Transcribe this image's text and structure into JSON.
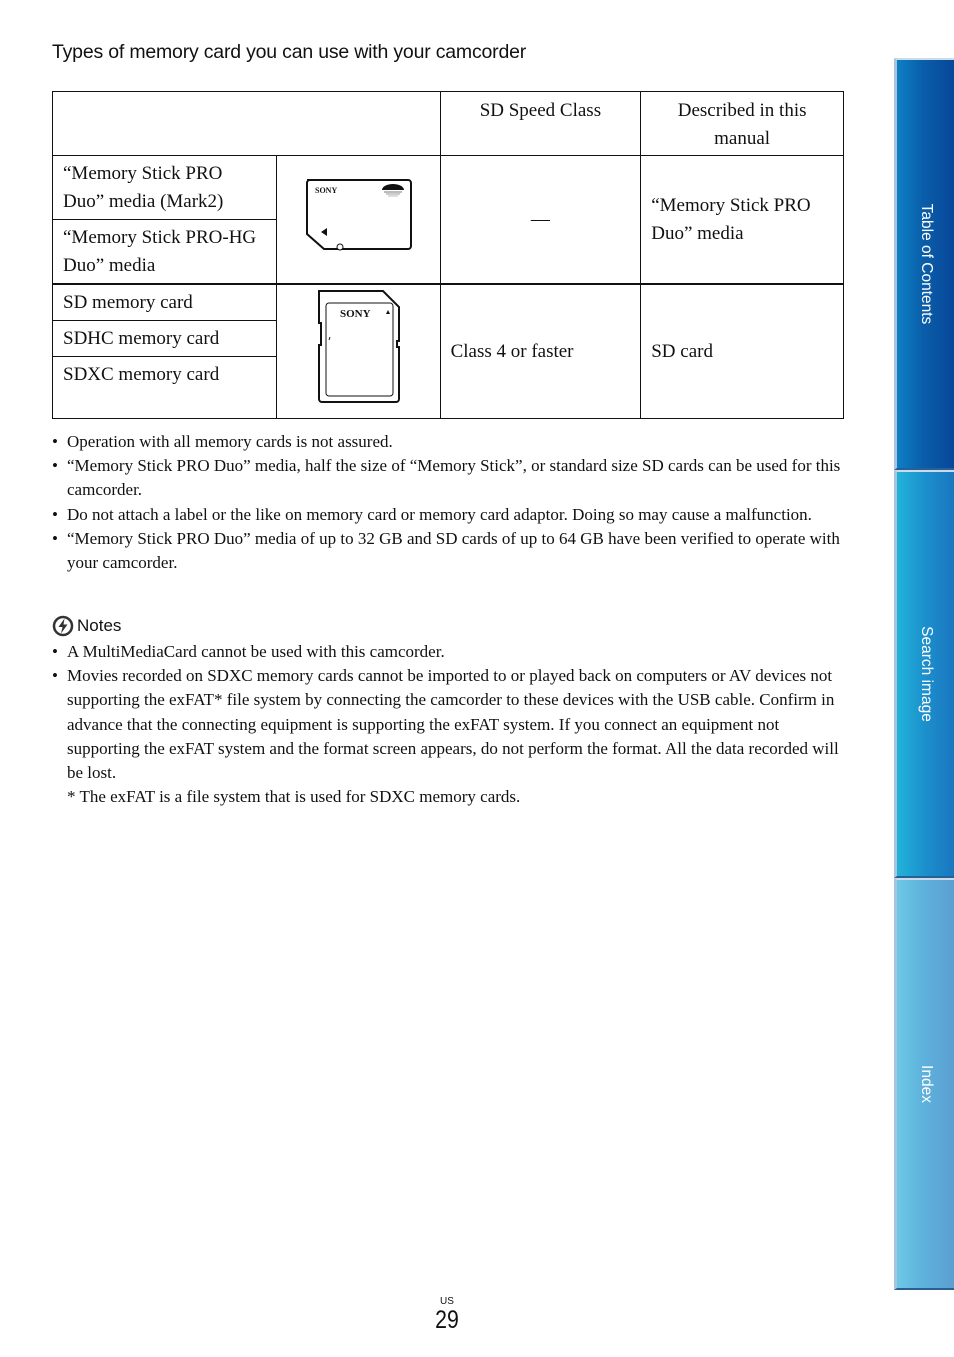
{
  "section_title": "Types of memory card you can use with your camcorder",
  "table": {
    "headers": {
      "blank": "",
      "speed_class": "SD Speed Class",
      "described": "Described in this manual"
    },
    "groups": [
      {
        "names": [
          "“Memory Stick PRO Duo” media (Mark2)",
          "“Memory Stick PRO-HG Duo” media"
        ],
        "image": "memory-stick-pro-duo",
        "image_brand": "SONY",
        "speed_class": "—",
        "described": "“Memory Stick PRO Duo” media"
      },
      {
        "names": [
          "SD memory card",
          "SDHC memory card",
          "SDXC memory card"
        ],
        "image": "sd-card",
        "image_brand": "SONY",
        "speed_class": "Class 4 or faster",
        "described": "SD card"
      }
    ]
  },
  "bullets": [
    "Operation with all memory cards is not assured.",
    "“Memory Stick PRO Duo” media, half the size of “Memory Stick”, or standard size SD cards can be used for this camcorder.",
    "Do not attach a label or the like on memory card or memory card adaptor. Doing so may cause a malfunction.",
    "“Memory Stick PRO Duo” media of up to 32 GB and SD cards of up to 64 GB have been verified to operate with your camcorder."
  ],
  "notes": {
    "icon": "notes-icon",
    "title": "Notes",
    "items": [
      "A MultiMediaCard cannot be used with this camcorder.",
      "Movies recorded on SDXC memory cards cannot be imported to or played back on computers or AV devices not supporting the exFAT* file system by connecting the camcorder to these devices with the USB cable. Confirm in advance that the connecting equipment is supporting the exFAT system. If you connect an equipment not supporting the exFAT system and the format screen appears, do not perform the format. All the data recorded will be lost."
    ],
    "footnote": "* The exFAT is a file system that is used for SDXC memory cards."
  },
  "side_tabs": [
    {
      "label": "Table of Contents",
      "color": "#0a5ea9"
    },
    {
      "label": "Search image",
      "color": "#1c8fcc"
    },
    {
      "label": "Index",
      "color": "#5eb2dc"
    }
  ],
  "page": {
    "region": "US",
    "number": "29"
  }
}
